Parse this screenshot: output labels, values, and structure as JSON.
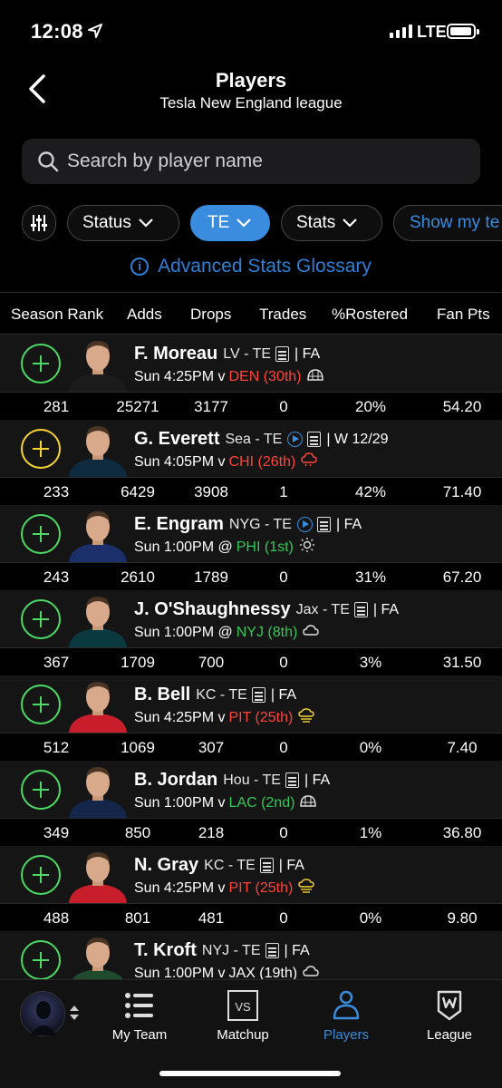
{
  "status_bar": {
    "time": "12:08",
    "network": "LTE"
  },
  "header": {
    "title": "Players",
    "subtitle": "Tesla New England league"
  },
  "search": {
    "placeholder": "Search by player name"
  },
  "filters": {
    "status": "Status",
    "position": "TE",
    "stats": "Stats",
    "show_my": "Show my te"
  },
  "glossary_link": "Advanced Stats Glossary",
  "columns": [
    "Season Rank",
    "Adds",
    "Drops",
    "Trades",
    "%Rostered",
    "Fan Pts"
  ],
  "players": [
    {
      "name": "F. Moreau",
      "team_pos": "LV - TE",
      "has_video": false,
      "roster_status": "| FA",
      "add_type": "free",
      "game": "Sun 4:25PM v",
      "opponent": "DEN (30th)",
      "opp_color": "hard",
      "weather": "dome-icon",
      "rank": "281",
      "adds": "25271",
      "drops": "3177",
      "trades": "0",
      "rostered": "20%",
      "fan_pts": "54.20",
      "jersey": "#1b1b1b"
    },
    {
      "name": "G. Everett",
      "team_pos": "Sea - TE",
      "has_video": true,
      "roster_status": "| W 12/29",
      "add_type": "waiver",
      "game": "Sun 4:05PM v",
      "opponent": "CHI (26th)",
      "opp_color": "hard",
      "weather": "rain-cloud-icon",
      "rank": "233",
      "adds": "6429",
      "drops": "3908",
      "trades": "1",
      "rostered": "42%",
      "fan_pts": "71.40",
      "jersey": "#0d2a3f"
    },
    {
      "name": "E. Engram",
      "team_pos": "NYG - TE",
      "has_video": true,
      "roster_status": "| FA",
      "add_type": "free",
      "game": "Sun 1:00PM @",
      "opponent": "PHI (1st)",
      "opp_color": "easy",
      "weather": "sun-icon",
      "rank": "243",
      "adds": "2610",
      "drops": "1789",
      "trades": "0",
      "rostered": "31%",
      "fan_pts": "67.20",
      "jersey": "#1b2f6a"
    },
    {
      "name": "J. O'Shaughnessy",
      "team_pos": "Jax - TE",
      "has_video": false,
      "roster_status": "| FA",
      "add_type": "free",
      "game": "Sun 1:00PM @",
      "opponent": "NYJ (8th)",
      "opp_color": "easy",
      "weather": "cloud-icon",
      "rank": "367",
      "adds": "1709",
      "drops": "700",
      "trades": "0",
      "rostered": "3%",
      "fan_pts": "31.50",
      "jersey": "#0a3a40"
    },
    {
      "name": "B. Bell",
      "team_pos": "KC - TE",
      "has_video": false,
      "roster_status": "| FA",
      "add_type": "free",
      "game": "Sun 4:25PM v",
      "opponent": "PIT (25th)",
      "opp_color": "hard",
      "weather": "wind-cloud-icon",
      "rank": "512",
      "adds": "1069",
      "drops": "307",
      "trades": "0",
      "rostered": "0%",
      "fan_pts": "7.40",
      "jersey": "#c81e2b"
    },
    {
      "name": "B. Jordan",
      "team_pos": "Hou - TE",
      "has_video": false,
      "roster_status": "| FA",
      "add_type": "free",
      "game": "Sun 1:00PM v",
      "opponent": "LAC (2nd)",
      "opp_color": "easy",
      "weather": "dome-icon",
      "rank": "349",
      "adds": "850",
      "drops": "218",
      "trades": "0",
      "rostered": "1%",
      "fan_pts": "36.80",
      "jersey": "#13264a"
    },
    {
      "name": "N. Gray",
      "team_pos": "KC - TE",
      "has_video": false,
      "roster_status": "| FA",
      "add_type": "free",
      "game": "Sun 4:25PM v",
      "opponent": "PIT (25th)",
      "opp_color": "hard",
      "weather": "wind-cloud-icon",
      "rank": "488",
      "adds": "801",
      "drops": "481",
      "trades": "0",
      "rostered": "0%",
      "fan_pts": "9.80",
      "jersey": "#c81e2b"
    },
    {
      "name": "T. Kroft",
      "team_pos": "NYJ - TE",
      "has_video": false,
      "roster_status": "| FA",
      "add_type": "free",
      "game": "Sun 1:00PM v",
      "opponent": "JAX (19th)",
      "opp_color": "neutral",
      "weather": "cloud-icon",
      "rank": "",
      "adds": "",
      "drops": "",
      "trades": "",
      "rostered": "",
      "fan_pts": "",
      "jersey": "#1f4a2e"
    }
  ],
  "tabbar": {
    "my_team": "My Team",
    "matchup": "Matchup",
    "players": "Players",
    "league": "League",
    "matchup_icon_text": "VS"
  },
  "colors": {
    "accent": "#3a8dde",
    "add_green": "#4cd964",
    "waiver_yellow": "#f6d332",
    "bad_matchup": "#ff453a",
    "good_matchup": "#34c759"
  }
}
